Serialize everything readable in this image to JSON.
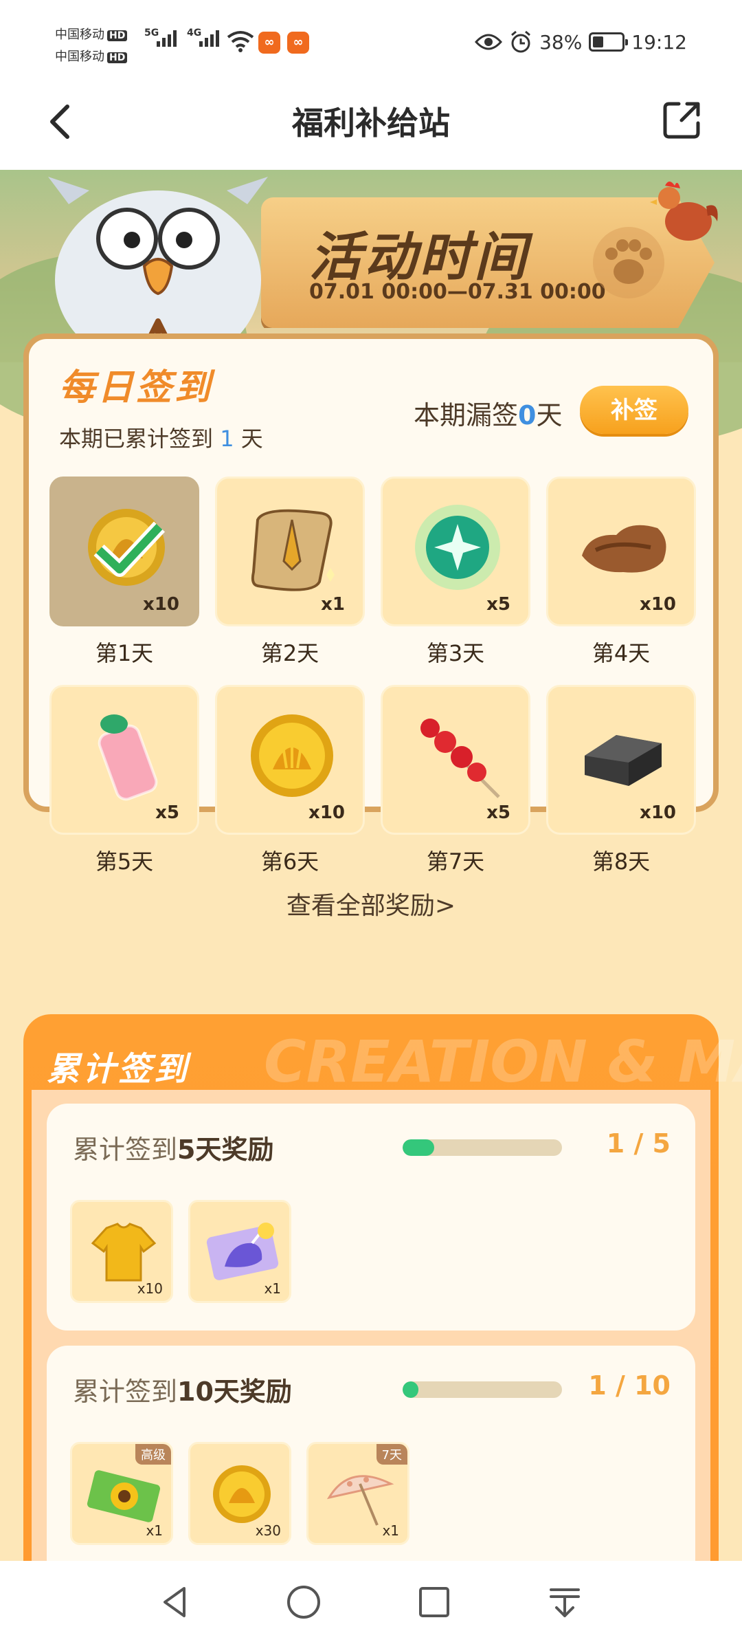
{
  "status_bar": {
    "carrier1": "中国移动",
    "carrier2": "中国移动",
    "hd": "HD",
    "sig1": "5G",
    "sig2": "4G",
    "battery_pct": "38%",
    "battery_level": 0.38,
    "time": "19:12"
  },
  "nav": {
    "title": "福利补给站"
  },
  "banner": {
    "title": "活动时间",
    "date_range": "07.01 00:00—07.31 00:00"
  },
  "daily": {
    "title": "每日签到",
    "accum_prefix": "本期已累计签到",
    "accum_num": "1",
    "accum_suffix": "天",
    "missed_prefix": "本期漏签",
    "missed_num": "0",
    "missed_suffix": "天",
    "makeup_button": "补签",
    "items": [
      {
        "day": "第1天",
        "qty": "x10",
        "icon": "shell-coin-icon",
        "signed": true
      },
      {
        "day": "第2天",
        "qty": "x1",
        "icon": "scroll-icon",
        "signed": false
      },
      {
        "day": "第3天",
        "qty": "x5",
        "icon": "green-orb-icon",
        "signed": false
      },
      {
        "day": "第4天",
        "qty": "x10",
        "icon": "leather-icon",
        "signed": false
      },
      {
        "day": "第5天",
        "qty": "x5",
        "icon": "milk-bottle-icon",
        "signed": false
      },
      {
        "day": "第6天",
        "qty": "x10",
        "icon": "shell-coin-icon",
        "signed": false
      },
      {
        "day": "第7天",
        "qty": "x5",
        "icon": "candied-haws-icon",
        "signed": false
      },
      {
        "day": "第8天",
        "qty": "x10",
        "icon": "iron-ingot-icon",
        "signed": false
      }
    ],
    "view_all": "查看全部奖励>"
  },
  "cumulative": {
    "title": "累计签到",
    "watermark": "CREATION & MAGIC",
    "milestones": [
      {
        "title_prefix": "累计签到",
        "title_num": "5",
        "title_suffix": "天奖励",
        "count": "1 / 5",
        "progress": 0.2,
        "rewards": [
          {
            "icon": "shirt-icon",
            "qty": "x10",
            "tag": ""
          },
          {
            "icon": "unicorn-card-icon",
            "qty": "x1",
            "tag": ""
          }
        ]
      },
      {
        "title_prefix": "累计签到",
        "title_num": "10",
        "title_suffix": "天奖励",
        "count": "1 / 10",
        "progress": 0.1,
        "rewards": [
          {
            "icon": "sunflower-ticket-icon",
            "qty": "x1",
            "tag": "高级"
          },
          {
            "icon": "shell-coin-icon",
            "qty": "x30",
            "tag": ""
          },
          {
            "icon": "parasol-icon",
            "qty": "x1",
            "tag": "7天"
          }
        ]
      }
    ]
  },
  "colors": {
    "accent_orange": "#f7a11d",
    "progress_green": "#34c77b",
    "highlight_blue": "#3f8fe0"
  }
}
